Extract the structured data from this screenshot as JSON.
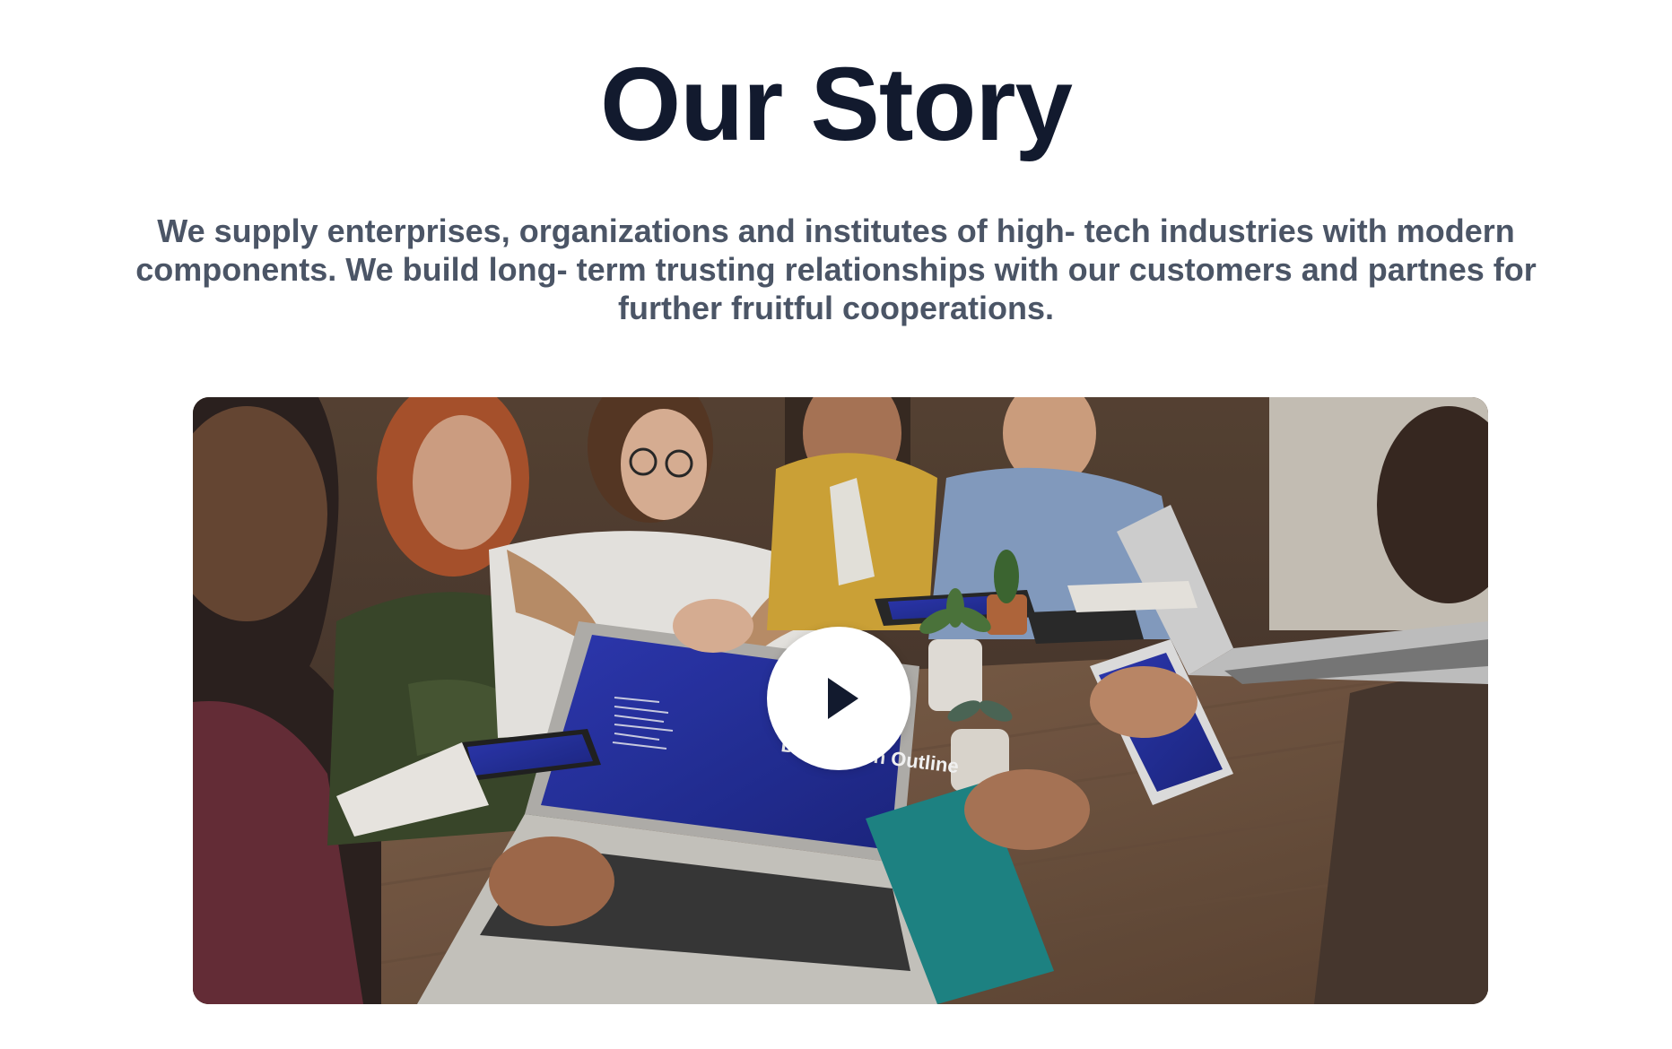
{
  "section": {
    "title": "Our Story",
    "description": "We supply enterprises, organizations and institutes of high- tech industries with modern components. We build long- term trusting relationships with our customers and partnes for further fruitful cooperations."
  },
  "video": {
    "play_icon": "play-icon",
    "screen_heading": "Discussion Outline"
  },
  "colors": {
    "title": "#121a2e",
    "description": "#4b5566",
    "background": "#ffffff",
    "play_button": "#ffffff",
    "play_icon": "#121a2e",
    "screen_accent": "#2a34a8"
  }
}
